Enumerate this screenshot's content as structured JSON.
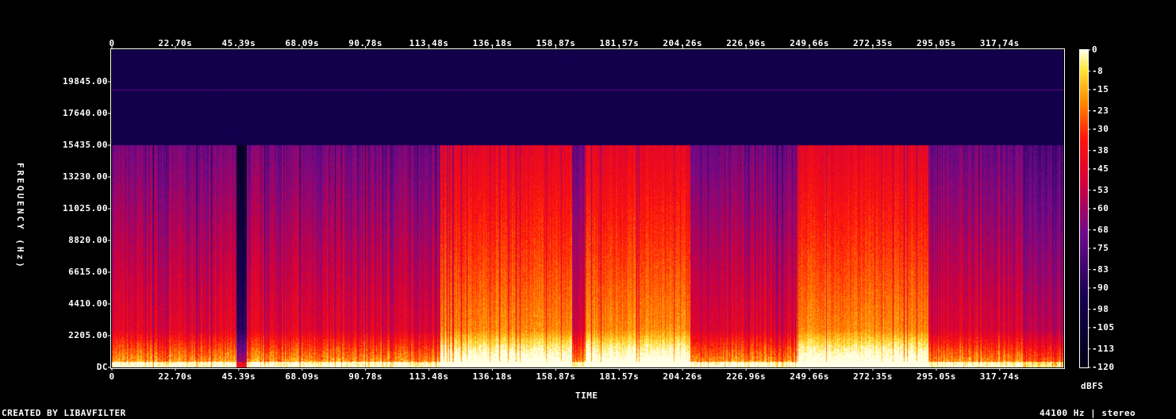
{
  "chart_data": {
    "type": "heatmap",
    "x_ticks": [
      "0",
      "22.70s",
      "45.39s",
      "68.09s",
      "90.78s",
      "113.48s",
      "136.18s",
      "158.87s",
      "181.57s",
      "204.26s",
      "226.96s",
      "249.66s",
      "272.35s",
      "295.05s",
      "317.74s"
    ],
    "x_tick_values": [
      0,
      22.7,
      45.39,
      68.09,
      90.78,
      113.48,
      136.18,
      158.87,
      181.57,
      204.26,
      226.96,
      249.66,
      272.35,
      295.05,
      317.74
    ],
    "x_range": [
      0,
      340.5
    ],
    "y_ticks": [
      "19845.00",
      "17640.00",
      "15435.00",
      "13230.00",
      "11025.00",
      "8820.00",
      "6615.00",
      "4410.00",
      "2205.00",
      "DC"
    ],
    "y_tick_values": [
      19845,
      17640,
      15435,
      13230,
      11025,
      8820,
      6615,
      4410,
      2205,
      0
    ],
    "y_range": [
      0,
      22050
    ],
    "xlabel": "TIME",
    "ylabel": "FREQUENCY (Hz)",
    "colorbar": {
      "label": "dBFS",
      "ticks": [
        "0",
        "-8",
        "-15",
        "-23",
        "-30",
        "-38",
        "-45",
        "-53",
        "-60",
        "-68",
        "-75",
        "-83",
        "-90",
        "-98",
        "-105",
        "-113",
        "-120"
      ],
      "range": [
        -120,
        0
      ]
    },
    "footer_left": "CREATED BY LIBAVFILTER",
    "footer_right": "44100 Hz | stereo",
    "loud_segments_s": [
      [
        117.5,
        164.5
      ],
      [
        169.5,
        209.0
      ],
      [
        245.0,
        292.0
      ]
    ],
    "cutoff_hz": 15435,
    "colors": {
      "low": "#04003a",
      "mid": "#d4006a",
      "high": "#ff2a1a",
      "peak": "#ffe070"
    }
  }
}
